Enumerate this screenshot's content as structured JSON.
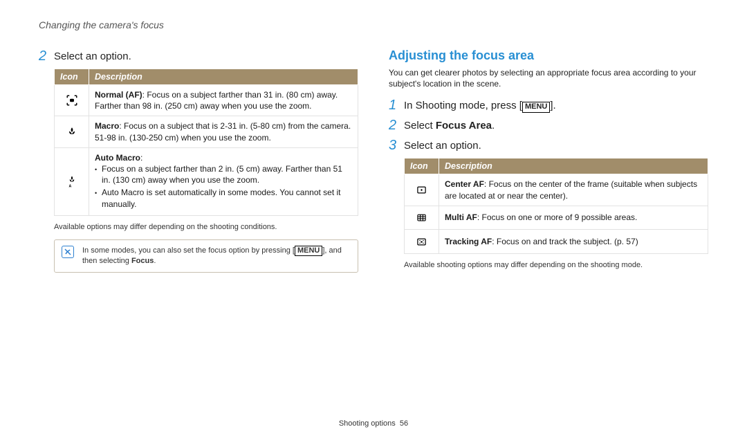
{
  "header": {
    "title": "Changing the camera's focus"
  },
  "left": {
    "step_num": "2",
    "step_text": "Select an option.",
    "table": {
      "headers": {
        "icon": "Icon",
        "desc": "Description"
      },
      "rows": [
        {
          "title": "Normal (AF)",
          "rest": ": Focus on a subject farther than 31 in. (80 cm) away. Farther than 98 in. (250 cm) away when you use the zoom."
        },
        {
          "title": "Macro",
          "rest": ": Focus on a subject that is 2-31 in. (5-80 cm) from the camera. 51-98 in. (130-250 cm) when you use the zoom."
        },
        {
          "title": "Auto Macro",
          "rest": ":",
          "bullets": [
            "Focus on a subject farther than 2 in. (5 cm) away. Farther than 51 in. (130 cm) away when you use the zoom.",
            "Auto Macro is set automatically in some modes. You cannot set it manually."
          ]
        }
      ]
    },
    "note": "Available options may differ depending on the shooting conditions.",
    "tip_pre": "In some modes, you can also set the focus option by pressing [",
    "tip_btn": "MENU",
    "tip_post": "], and then selecting ",
    "tip_bold": "Focus",
    "tip_end": "."
  },
  "right": {
    "title": "Adjusting the focus area",
    "intro": "You can get clearer photos by selecting an appropriate focus area according to your subject's location in the scene.",
    "steps": [
      {
        "num": "1",
        "pre": "In Shooting mode, press [",
        "btn": "MENU",
        "post": "]."
      },
      {
        "num": "2",
        "pre": "Select ",
        "bold": "Focus Area",
        "post": "."
      },
      {
        "num": "3",
        "pre": "Select an option.",
        "bold": "",
        "post": ""
      }
    ],
    "table": {
      "headers": {
        "icon": "Icon",
        "desc": "Description"
      },
      "rows": [
        {
          "title": "Center AF",
          "rest": ": Focus on the center of the frame (suitable when subjects are located at or near the center)."
        },
        {
          "title": "Multi AF",
          "rest": ": Focus on one or more of 9 possible areas."
        },
        {
          "title": "Tracking AF",
          "rest": ": Focus on and track the subject. (p. 57)"
        }
      ]
    },
    "note": "Available shooting options may differ depending on the shooting mode."
  },
  "footer": {
    "section": "Shooting options",
    "page": "56"
  }
}
